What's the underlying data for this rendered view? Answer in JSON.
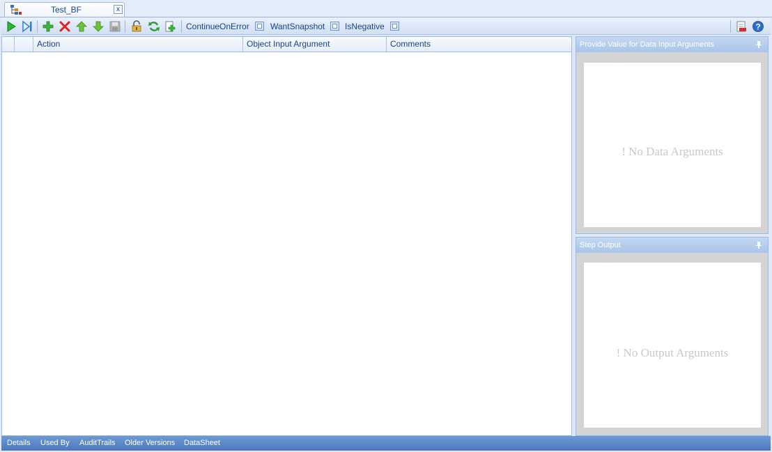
{
  "tab": {
    "title": "Test_BF",
    "close_glyph": "x",
    "icon": "tree-structure-icon"
  },
  "toolbar": {
    "buttons": [
      {
        "name": "run-icon",
        "color": "#2db52d"
      },
      {
        "name": "run-step-icon",
        "color": "#2a7fd4"
      },
      {
        "name": "add-icon",
        "color": "#3cb53c"
      },
      {
        "name": "delete-icon",
        "color": "#e02020"
      },
      {
        "name": "move-up-icon",
        "color": "#6cc43a"
      },
      {
        "name": "move-down-icon",
        "color": "#6cc43a"
      },
      {
        "name": "save-icon",
        "color": "#a0a0a0"
      },
      {
        "name": "lock-icon",
        "color": "#c89b2c"
      },
      {
        "name": "refresh-icon",
        "color": "#2e9a3a"
      },
      {
        "name": "import-icon",
        "color": "#2e9a3a"
      }
    ],
    "options": [
      {
        "label": "ContinueOnError"
      },
      {
        "label": "WantSnapshot"
      },
      {
        "label": "IsNegative"
      }
    ],
    "right_buttons": [
      {
        "name": "report-icon"
      },
      {
        "name": "help-icon"
      }
    ]
  },
  "grid": {
    "columns": [
      "",
      "",
      "Action",
      "Object Input Argument",
      "Comments"
    ],
    "rows": []
  },
  "data_panel": {
    "title": "Provide Value for Data Input Arguments",
    "empty": "! No Data Arguments"
  },
  "output_panel": {
    "title": "Step Output",
    "empty": "! No Output Arguments"
  },
  "bottom_tabs": [
    "Details",
    "Used By",
    "AuditTrails",
    "Older Versions",
    "DataSheet"
  ]
}
